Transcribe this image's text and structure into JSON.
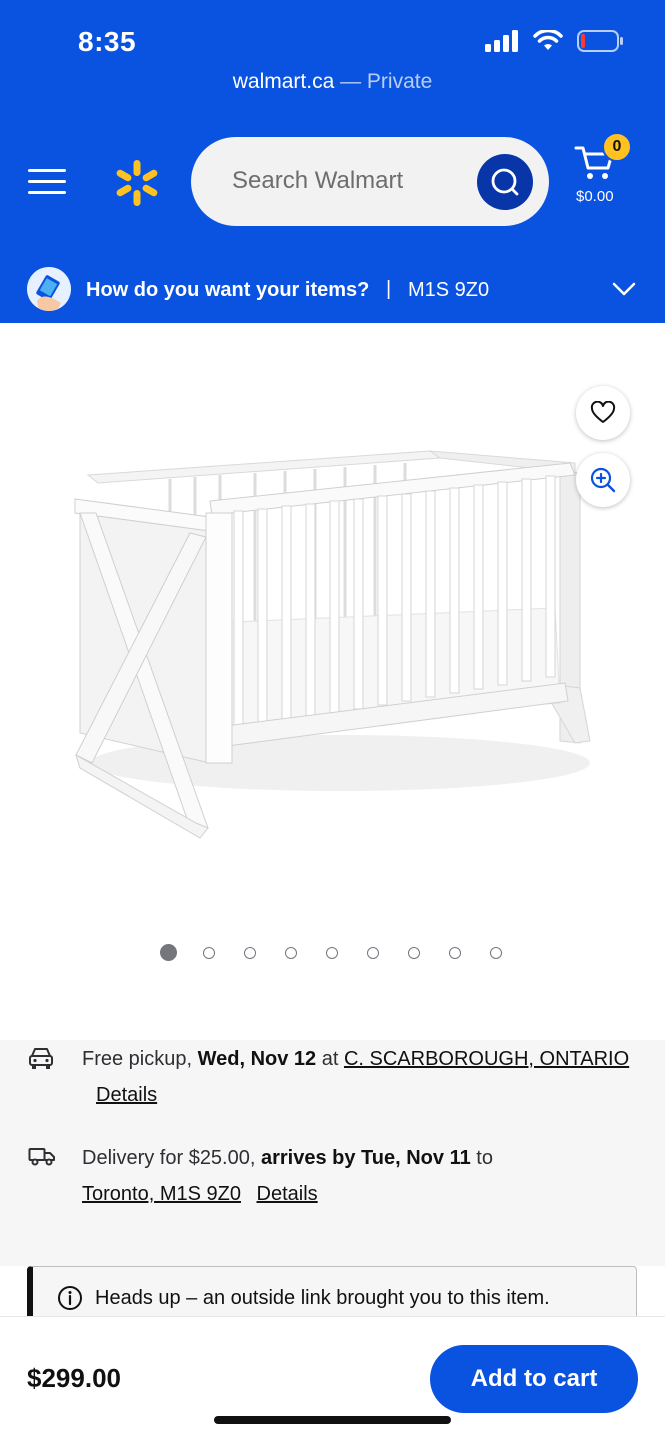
{
  "status_bar": {
    "time": "8:35"
  },
  "browser": {
    "domain": "walmart.ca",
    "mode": " — Private"
  },
  "header": {
    "search_placeholder": "Search Walmart",
    "cart_count": "0",
    "cart_total": "$0.00"
  },
  "fulfillment": {
    "question": "How do you want your items?",
    "separator": "|",
    "postal_code": "M1S 9Z0"
  },
  "product": {
    "image_count": 9,
    "active_image_index": 0
  },
  "pickup": {
    "prefix": "Free pickup, ",
    "date": "Wed, Nov 12",
    "at": " at ",
    "store": "C. SCARBOROUGH, ONTARIO",
    "details": "Details"
  },
  "delivery": {
    "prefix": "Delivery for $25.00, ",
    "arrival": "arrives by Tue, Nov 11",
    "to": " to",
    "location": "Toronto, M1S 9Z0",
    "details": "Details"
  },
  "notice": {
    "text": "Heads up – an outside link brought you to this item."
  },
  "purchase": {
    "price": "$299.00",
    "add_to_cart": "Add to cart"
  },
  "colors": {
    "brand_blue": "#0a52e0",
    "dark_blue": "#0836a8",
    "spark_yellow": "#ffc220"
  }
}
